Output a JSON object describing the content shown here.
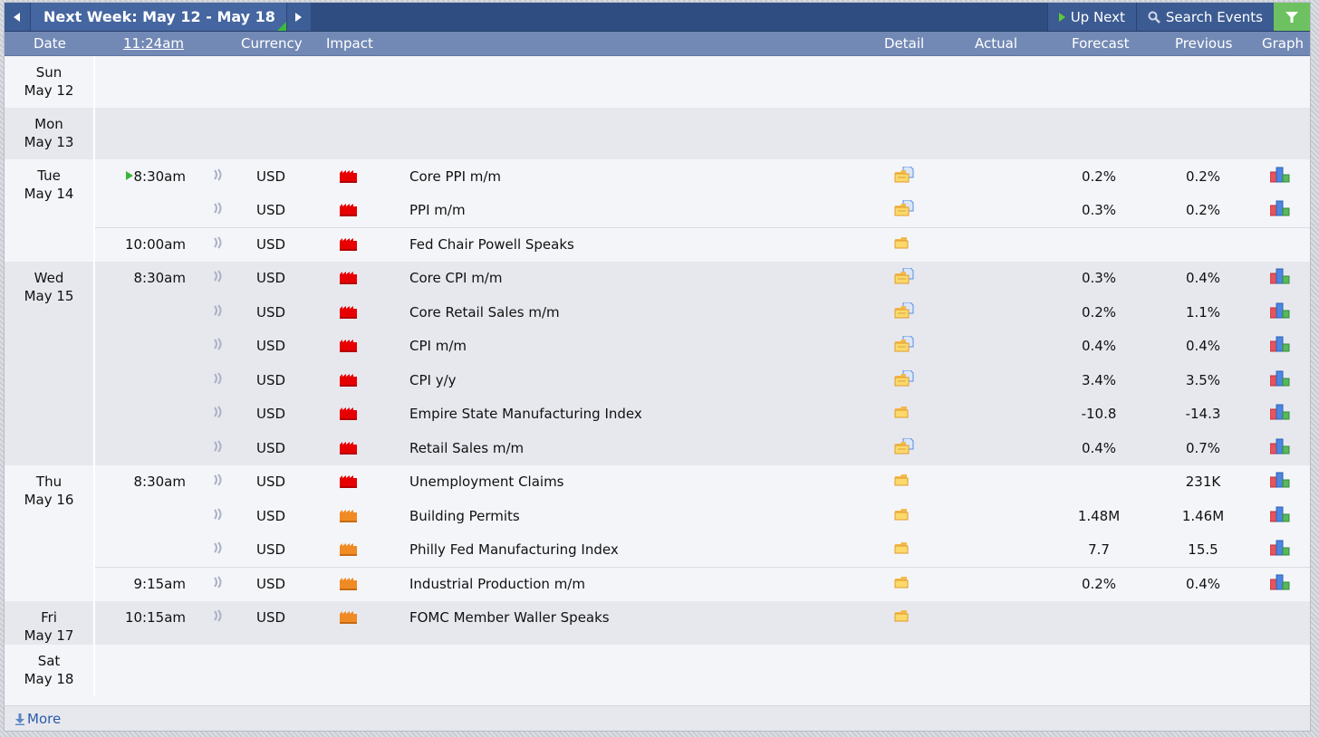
{
  "toolbar": {
    "week_title": "Next Week: May 12 - May 18",
    "up_next_label": "Up Next",
    "search_label": "Search Events"
  },
  "columns": {
    "date": "Date",
    "time": "11:24am",
    "currency": "Currency",
    "impact": "Impact",
    "detail": "Detail",
    "actual": "Actual",
    "forecast": "Forecast",
    "previous": "Previous",
    "graph": "Graph"
  },
  "colors": {
    "high_impact": "#e60000",
    "medium_impact": "#f08a24",
    "header_bg": "#2f4d80",
    "column_header_bg": "#7389b5",
    "filter_green": "#6dc160"
  },
  "days": [
    {
      "dname": "Sun",
      "ddate": "May 12",
      "events": []
    },
    {
      "dname": "Mon",
      "ddate": "May 13",
      "events": []
    },
    {
      "dname": "Tue",
      "ddate": "May 14",
      "events": [
        {
          "time": "8:30am",
          "upnext": true,
          "currency": "USD",
          "impact": "high",
          "title": "Core PPI m/m",
          "detail": "folder-doc",
          "actual": "",
          "forecast": "0.2%",
          "previous": "0.2%",
          "graph": true
        },
        {
          "time": "",
          "currency": "USD",
          "impact": "high",
          "title": "PPI m/m",
          "detail": "folder-doc",
          "actual": "",
          "forecast": "0.3%",
          "previous": "0.2%",
          "graph": true
        },
        {
          "time": "10:00am",
          "sep": true,
          "currency": "USD",
          "impact": "high",
          "title": "Fed Chair Powell Speaks",
          "detail": "folder",
          "actual": "",
          "forecast": "",
          "previous": "",
          "graph": false
        }
      ]
    },
    {
      "dname": "Wed",
      "ddate": "May 15",
      "events": [
        {
          "time": "8:30am",
          "currency": "USD",
          "impact": "high",
          "title": "Core CPI m/m",
          "detail": "folder-doc",
          "actual": "",
          "forecast": "0.3%",
          "previous": "0.4%",
          "graph": true
        },
        {
          "time": "",
          "currency": "USD",
          "impact": "high",
          "title": "Core Retail Sales m/m",
          "detail": "folder-doc",
          "actual": "",
          "forecast": "0.2%",
          "previous": "1.1%",
          "graph": true
        },
        {
          "time": "",
          "currency": "USD",
          "impact": "high",
          "title": "CPI m/m",
          "detail": "folder-doc",
          "actual": "",
          "forecast": "0.4%",
          "previous": "0.4%",
          "graph": true
        },
        {
          "time": "",
          "currency": "USD",
          "impact": "high",
          "title": "CPI y/y",
          "detail": "folder-doc",
          "actual": "",
          "forecast": "3.4%",
          "previous": "3.5%",
          "graph": true
        },
        {
          "time": "",
          "currency": "USD",
          "impact": "high",
          "title": "Empire State Manufacturing Index",
          "detail": "folder",
          "actual": "",
          "forecast": "-10.8",
          "previous": "-14.3",
          "graph": true
        },
        {
          "time": "",
          "currency": "USD",
          "impact": "high",
          "title": "Retail Sales m/m",
          "detail": "folder-doc",
          "actual": "",
          "forecast": "0.4%",
          "previous": "0.7%",
          "graph": true
        }
      ]
    },
    {
      "dname": "Thu",
      "ddate": "May 16",
      "events": [
        {
          "time": "8:30am",
          "currency": "USD",
          "impact": "high",
          "title": "Unemployment Claims",
          "detail": "folder",
          "actual": "",
          "forecast": "",
          "previous": "231K",
          "graph": true
        },
        {
          "time": "",
          "currency": "USD",
          "impact": "medium",
          "title": "Building Permits",
          "detail": "folder",
          "actual": "",
          "forecast": "1.48M",
          "previous": "1.46M",
          "graph": true
        },
        {
          "time": "",
          "currency": "USD",
          "impact": "medium",
          "title": "Philly Fed Manufacturing Index",
          "detail": "folder",
          "actual": "",
          "forecast": "7.7",
          "previous": "15.5",
          "graph": true
        },
        {
          "time": "9:15am",
          "sep": true,
          "currency": "USD",
          "impact": "medium",
          "title": "Industrial Production m/m",
          "detail": "folder",
          "actual": "",
          "forecast": "0.2%",
          "previous": "0.4%",
          "graph": true
        }
      ]
    },
    {
      "dname": "Fri",
      "ddate": "May 17",
      "events": [
        {
          "time": "10:15am",
          "currency": "USD",
          "impact": "medium",
          "title": "FOMC Member Waller Speaks",
          "detail": "folder",
          "actual": "",
          "forecast": "",
          "previous": "",
          "graph": false
        }
      ]
    },
    {
      "dname": "Sat",
      "ddate": "May 18",
      "events": []
    }
  ],
  "footer": {
    "more_label": "More"
  }
}
